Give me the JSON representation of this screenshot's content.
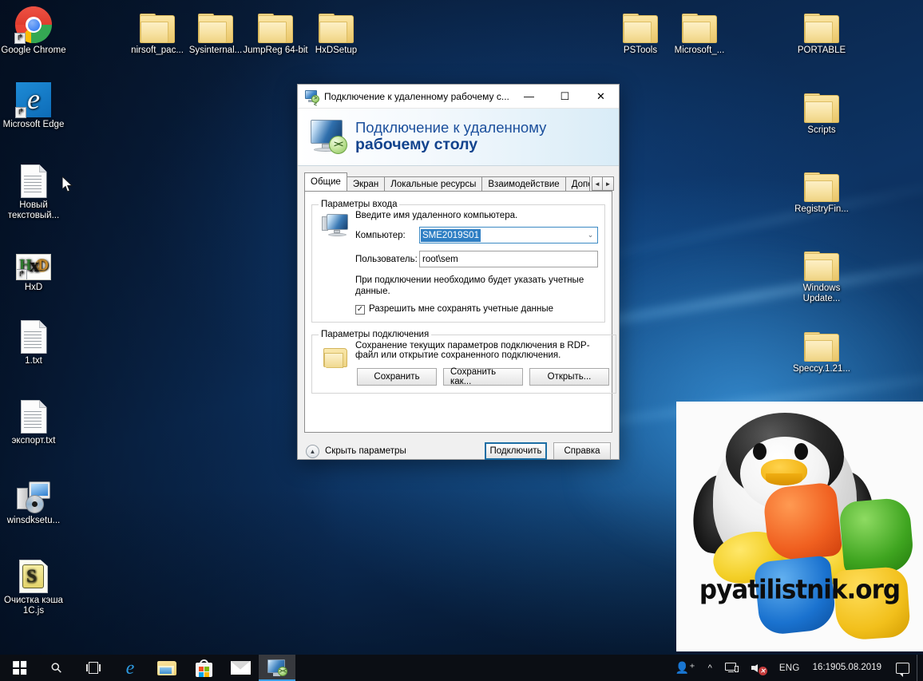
{
  "desktop": {
    "icons_left": [
      {
        "label": "Google Chrome",
        "icon": "chrome-icon"
      },
      {
        "label": "Microsoft Edge",
        "icon": "edge-icon"
      },
      {
        "label": "Новый текстовый...",
        "icon": "text-file-icon"
      },
      {
        "label": "HxD",
        "icon": "hxd-icon"
      },
      {
        "label": "1.txt",
        "icon": "text-file-icon"
      },
      {
        "label": "экспорт.txt",
        "icon": "text-file-icon"
      },
      {
        "label": "winsdksetu...",
        "icon": "setup-installer-icon"
      },
      {
        "label": "Очистка кэша 1C.js",
        "icon": "js-script-icon"
      }
    ],
    "icons_top": [
      {
        "label": "nirsoft_pac...",
        "icon": "folder-icon"
      },
      {
        "label": "Sysinternal...",
        "icon": "folder-icon"
      },
      {
        "label": "JumpReg 64-bit",
        "icon": "folder-icon"
      },
      {
        "label": "HxDSetup",
        "icon": "folder-icon"
      },
      {
        "label": "PSTools",
        "icon": "folder-icon"
      },
      {
        "label": "Microsoft_...",
        "icon": "folder-icon"
      },
      {
        "label": "PORTABLE",
        "icon": "folder-icon"
      }
    ],
    "icons_right": [
      {
        "label": "Scripts",
        "icon": "folder-icon"
      },
      {
        "label": "RegistryFin...",
        "icon": "folder-icon"
      },
      {
        "label": "Windows Update...",
        "icon": "folder-icon"
      },
      {
        "label": "Speccy.1.21...",
        "icon": "folder-icon"
      }
    ]
  },
  "watermark": {
    "text": "pyatilistnik.org"
  },
  "dialog": {
    "titlebar": {
      "icon": "remote-desktop-icon",
      "title": "Подключение к удаленному рабочему с...",
      "minimize": "—",
      "maximize": "☐",
      "close": "✕"
    },
    "header": {
      "line1": "Подключение к удаленному",
      "line2": "рабочему столу"
    },
    "tabs": [
      {
        "label": "Общие",
        "active": true
      },
      {
        "label": "Экран",
        "active": false
      },
      {
        "label": "Локальные ресурсы",
        "active": false
      },
      {
        "label": "Взаимодействие",
        "active": false
      },
      {
        "label": "Дополни",
        "active": false
      }
    ],
    "tab_scroll": {
      "left": "◄",
      "right": "►"
    },
    "logon_group": {
      "legend": "Параметры входа",
      "icon": "computer-monitor-icon",
      "instruction": "Введите имя удаленного компьютера.",
      "computer_label": "Компьютер:",
      "computer_value": "SME2019S01",
      "computer_caret": "⌄",
      "user_label": "Пользователь:",
      "user_value": "root\\sem",
      "note": "При подключении необходимо будет указать учетные данные.",
      "checkbox_label": "Разрешить мне сохранять учетные данные",
      "checkbox_checked": true,
      "checkbox_glyph": "✓"
    },
    "connection_group": {
      "legend": "Параметры подключения",
      "icon": "folder-icon",
      "description": "Сохранение текущих параметров подключения в RDP-файл или открытие сохраненного подключения.",
      "buttons": [
        {
          "label": "Сохранить"
        },
        {
          "label": "Сохранить как..."
        },
        {
          "label": "Открыть..."
        }
      ]
    },
    "footer": {
      "hide_params_icon": "chevron-up-circle-icon",
      "hide_params_label": "Скрыть параметры",
      "connect_label": "Подключить",
      "help_label": "Справка"
    }
  },
  "taskbar": {
    "items": [
      {
        "name": "start-button",
        "icon": "windows-logo-icon"
      },
      {
        "name": "search-button",
        "icon": "search-icon"
      },
      {
        "name": "task-view-button",
        "icon": "task-view-icon"
      },
      {
        "name": "edge-button",
        "icon": "edge-icon"
      },
      {
        "name": "file-explorer-button",
        "icon": "folder-icon"
      },
      {
        "name": "microsoft-store-button",
        "icon": "store-bag-icon"
      },
      {
        "name": "mail-button",
        "icon": "mail-envelope-icon"
      },
      {
        "name": "remote-desktop-button",
        "icon": "remote-desktop-icon"
      }
    ],
    "tray": {
      "people": "people-icon",
      "chevron": "^",
      "network": "network-icon",
      "volume": "volume-muted-icon",
      "volume_badge": "✕",
      "language": "ENG",
      "time": "16:19",
      "date": "05.08.2019",
      "action_center": "action-center-icon"
    }
  },
  "colors": {
    "accent": "#1c6ea4",
    "selection": "#2f7fc4",
    "header_title": "#12438d",
    "taskbar": "#0b0e14",
    "folder": "#f0d584"
  }
}
